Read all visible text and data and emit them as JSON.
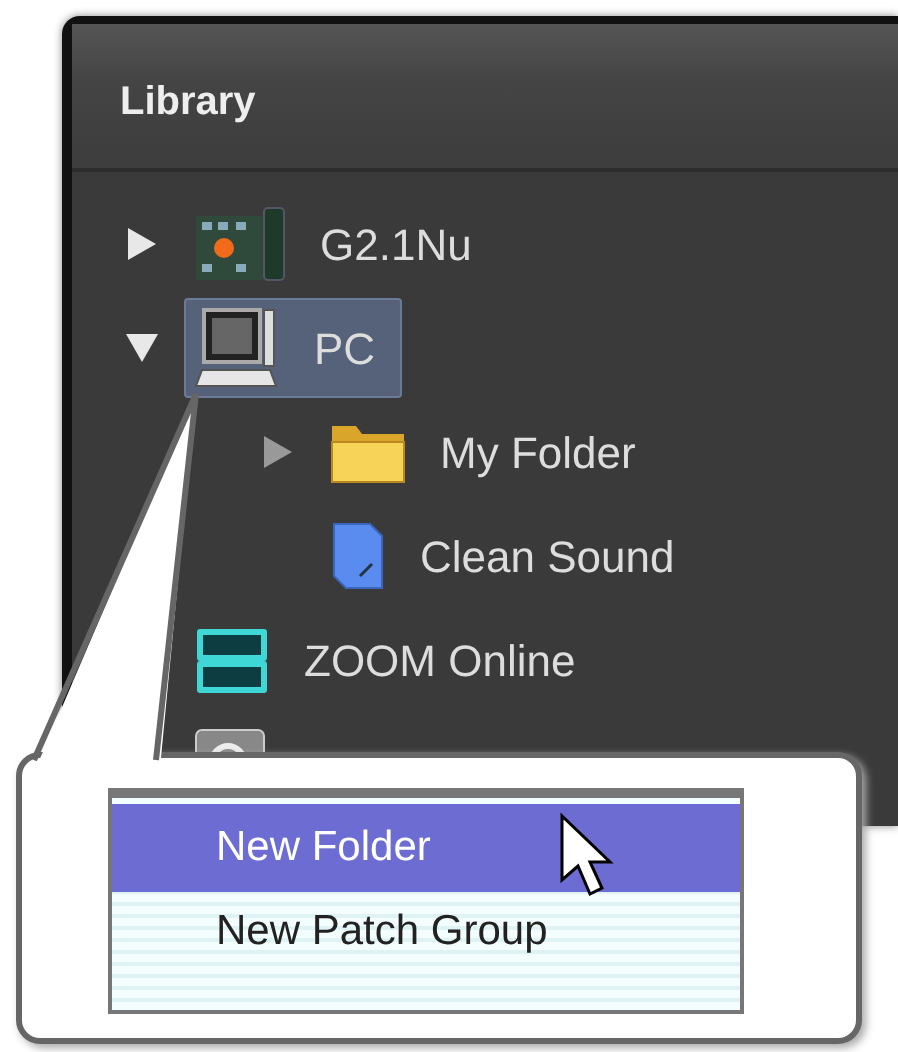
{
  "panel": {
    "title": "Library"
  },
  "tree": [
    {
      "label": "G2.1Nu",
      "kind": "device",
      "expanded": false,
      "selected": false
    },
    {
      "label": "PC",
      "kind": "computer",
      "expanded": true,
      "selected": true,
      "children": [
        {
          "label": "My Folder",
          "kind": "folder",
          "expanded": false,
          "selected": false
        },
        {
          "label": "Clean Sound",
          "kind": "patch",
          "selected": false
        }
      ]
    },
    {
      "label": "ZOOM Online",
      "kind": "online",
      "expanded": false,
      "selected": false
    },
    {
      "kind": "search",
      "selected": false
    }
  ],
  "context_menu": [
    {
      "label": "New Folder",
      "selected": true
    },
    {
      "label": "New Patch Group",
      "selected": false
    }
  ]
}
